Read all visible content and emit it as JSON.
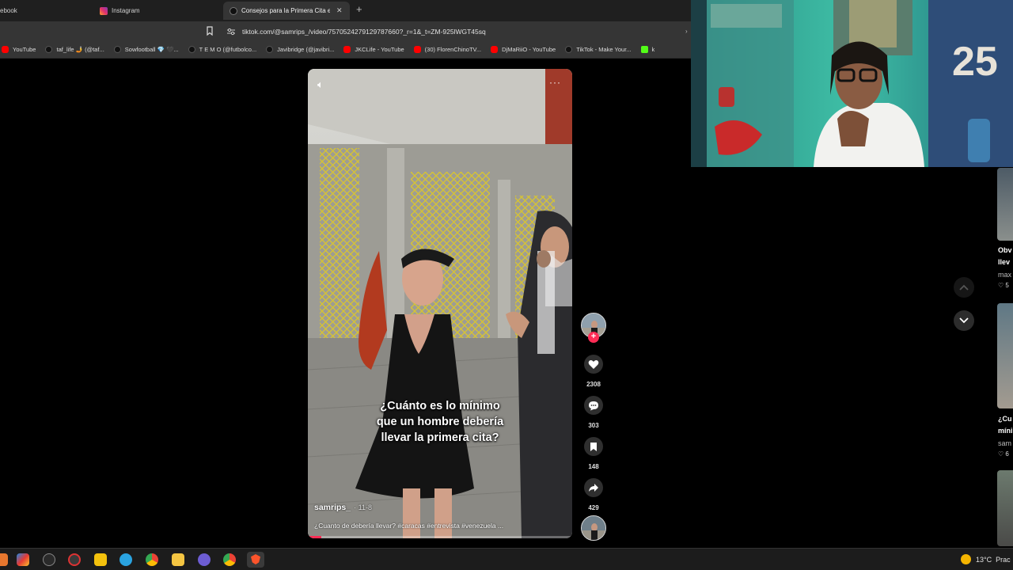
{
  "browser": {
    "tabs": [
      {
        "label": "ebook",
        "active": false
      },
      {
        "label": "Instagram",
        "active": false
      },
      {
        "label": "Consejos para la Primera Cita en",
        "active": true
      }
    ],
    "new_tab": "+",
    "close_glyph": "✕",
    "url": "tiktok.com/@samrips_/video/7570524279129787660?_r=1&_t=ZM-925lWGT45sq",
    "bookmarks": [
      {
        "label": "YouTube",
        "icon": "youtube-icon"
      },
      {
        "label": "taf_life 🤳 (@taf...",
        "icon": "tiktok-icon"
      },
      {
        "label": "Sowfootball 💎 🖤...",
        "icon": "tiktok-icon"
      },
      {
        "label": "T E M O (@futbolco...",
        "icon": "tiktok-icon"
      },
      {
        "label": "Javibridge (@javibri...",
        "icon": "tiktok-icon"
      },
      {
        "label": "JKCLife - YouTube",
        "icon": "youtube-icon"
      },
      {
        "label": "(30) FlorenChinoTV...",
        "icon": "youtube-icon"
      },
      {
        "label": "DjMaRiiO - YouTube",
        "icon": "youtube-icon"
      },
      {
        "label": "TikTok - Make Your...",
        "icon": "tiktok-icon"
      },
      {
        "label": "k",
        "icon": "kick-icon"
      }
    ]
  },
  "video": {
    "volume_icon": "speaker-icon",
    "more_icon": "···",
    "caption_lines": [
      "¿Cuánto es lo mínimo",
      "que un hombre debería",
      "llevar la primera cita?"
    ],
    "author": "samrips_",
    "date": "· 11-8",
    "description": "¿Cuanto de debería llevar? #caracas #entrevista #venezuela ...",
    "progress": 0.05
  },
  "actions": {
    "likes": "2308",
    "comments": "303",
    "saves": "148",
    "shares": "429",
    "follow": "+"
  },
  "side_panel": {
    "items": [
      {
        "title": "Obv",
        "title2": "llev",
        "user": "max",
        "likes": "♡ 5"
      },
      {
        "title": "¿Cu",
        "title2": "míni",
        "user": "sam",
        "likes": "♡ 6"
      }
    ]
  },
  "taskbar": {
    "weather": "13°C",
    "weather_text": "Prac"
  },
  "colors": {
    "accent": "#fe2c55",
    "background": "#000000",
    "browser_chrome": "#353535"
  }
}
